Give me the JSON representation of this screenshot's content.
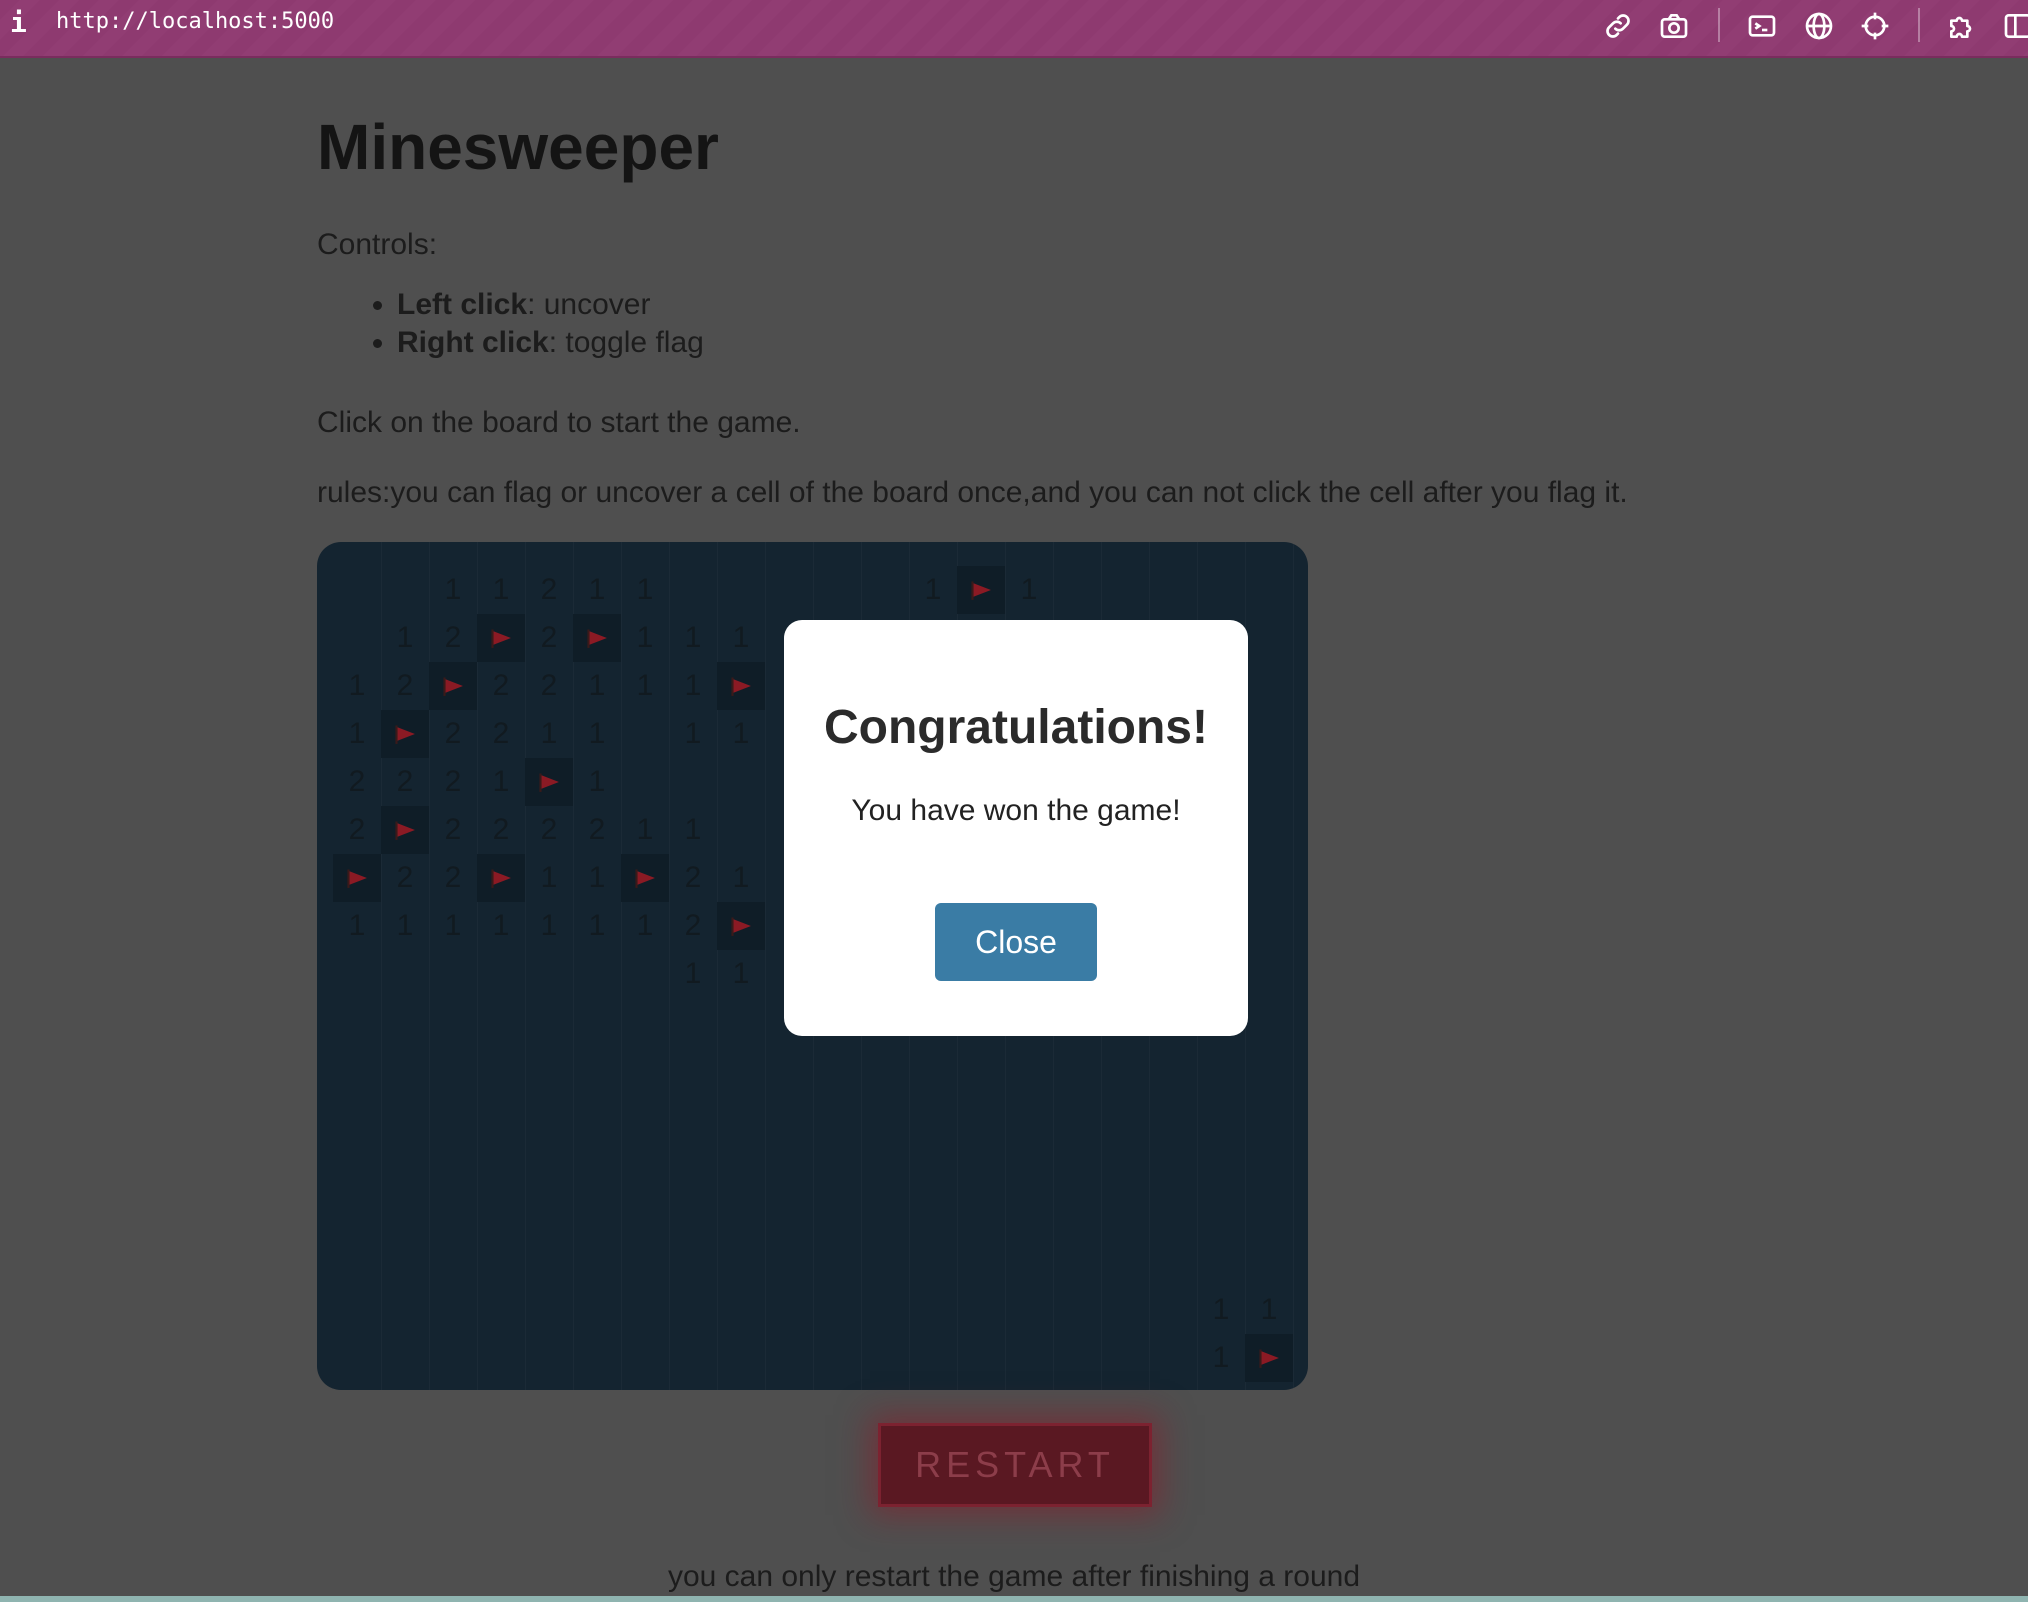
{
  "browser": {
    "info_glyph": "i",
    "url": "http://localhost:5000",
    "toolbar_icons": [
      "link-icon",
      "camera-icon",
      "terminal-icon",
      "globe-icon",
      "crosshair-icon",
      "puzzle-icon",
      "sidebar-icon"
    ]
  },
  "page": {
    "title": "Minesweeper",
    "controls_label": "Controls:",
    "controls": [
      {
        "key": "Left click",
        "action": ": uncover"
      },
      {
        "key": "Right click",
        "action": ": toggle flag"
      }
    ],
    "start_text": "Click on the board to start the game.",
    "rules_text": "rules:you can flag or uncover a cell of the board once,and you can not click the cell after you flag it.",
    "restart_label": "RESTART",
    "restart_note": "you can only restart the game after finishing a round"
  },
  "board": {
    "cells": [
      {
        "r": 0,
        "c": 2,
        "v": "1"
      },
      {
        "r": 0,
        "c": 3,
        "v": "1"
      },
      {
        "r": 0,
        "c": 4,
        "v": "2"
      },
      {
        "r": 0,
        "c": 5,
        "v": "1"
      },
      {
        "r": 0,
        "c": 6,
        "v": "1"
      },
      {
        "r": 0,
        "c": 12,
        "v": "1"
      },
      {
        "r": 0,
        "c": 13,
        "flag": true
      },
      {
        "r": 0,
        "c": 14,
        "v": "1"
      },
      {
        "r": 1,
        "c": 1,
        "v": "1"
      },
      {
        "r": 1,
        "c": 2,
        "v": "2"
      },
      {
        "r": 1,
        "c": 3,
        "flag": true
      },
      {
        "r": 1,
        "c": 4,
        "v": "2"
      },
      {
        "r": 1,
        "c": 5,
        "flag": true
      },
      {
        "r": 1,
        "c": 6,
        "v": "1"
      },
      {
        "r": 1,
        "c": 7,
        "v": "1"
      },
      {
        "r": 1,
        "c": 8,
        "v": "1"
      },
      {
        "r": 2,
        "c": 0,
        "v": "1"
      },
      {
        "r": 2,
        "c": 1,
        "v": "2"
      },
      {
        "r": 2,
        "c": 2,
        "flag": true
      },
      {
        "r": 2,
        "c": 3,
        "v": "2"
      },
      {
        "r": 2,
        "c": 4,
        "v": "2"
      },
      {
        "r": 2,
        "c": 5,
        "v": "1"
      },
      {
        "r": 2,
        "c": 6,
        "v": "1"
      },
      {
        "r": 2,
        "c": 7,
        "v": "1"
      },
      {
        "r": 2,
        "c": 8,
        "flag": true
      },
      {
        "r": 3,
        "c": 0,
        "v": "1"
      },
      {
        "r": 3,
        "c": 1,
        "flag": true
      },
      {
        "r": 3,
        "c": 2,
        "v": "2"
      },
      {
        "r": 3,
        "c": 3,
        "v": "2"
      },
      {
        "r": 3,
        "c": 4,
        "v": "1"
      },
      {
        "r": 3,
        "c": 5,
        "v": "1"
      },
      {
        "r": 3,
        "c": 7,
        "v": "1"
      },
      {
        "r": 3,
        "c": 8,
        "v": "1"
      },
      {
        "r": 4,
        "c": 0,
        "v": "2"
      },
      {
        "r": 4,
        "c": 1,
        "v": "2"
      },
      {
        "r": 4,
        "c": 2,
        "v": "2"
      },
      {
        "r": 4,
        "c": 3,
        "v": "1"
      },
      {
        "r": 4,
        "c": 4,
        "flag": true
      },
      {
        "r": 4,
        "c": 5,
        "v": "1"
      },
      {
        "r": 5,
        "c": 0,
        "v": "2"
      },
      {
        "r": 5,
        "c": 1,
        "flag": true
      },
      {
        "r": 5,
        "c": 2,
        "v": "2"
      },
      {
        "r": 5,
        "c": 3,
        "v": "2"
      },
      {
        "r": 5,
        "c": 4,
        "v": "2"
      },
      {
        "r": 5,
        "c": 5,
        "v": "2"
      },
      {
        "r": 5,
        "c": 6,
        "v": "1"
      },
      {
        "r": 5,
        "c": 7,
        "v": "1"
      },
      {
        "r": 6,
        "c": 0,
        "flag": true
      },
      {
        "r": 6,
        "c": 1,
        "v": "2"
      },
      {
        "r": 6,
        "c": 2,
        "v": "2"
      },
      {
        "r": 6,
        "c": 3,
        "flag": true
      },
      {
        "r": 6,
        "c": 4,
        "v": "1"
      },
      {
        "r": 6,
        "c": 5,
        "v": "1"
      },
      {
        "r": 6,
        "c": 6,
        "flag": true
      },
      {
        "r": 6,
        "c": 7,
        "v": "2"
      },
      {
        "r": 6,
        "c": 8,
        "v": "1"
      },
      {
        "r": 7,
        "c": 0,
        "v": "1"
      },
      {
        "r": 7,
        "c": 1,
        "v": "1"
      },
      {
        "r": 7,
        "c": 2,
        "v": "1"
      },
      {
        "r": 7,
        "c": 3,
        "v": "1"
      },
      {
        "r": 7,
        "c": 4,
        "v": "1"
      },
      {
        "r": 7,
        "c": 5,
        "v": "1"
      },
      {
        "r": 7,
        "c": 6,
        "v": "1"
      },
      {
        "r": 7,
        "c": 7,
        "v": "2"
      },
      {
        "r": 7,
        "c": 8,
        "flag": true
      },
      {
        "r": 8,
        "c": 7,
        "v": "1"
      },
      {
        "r": 8,
        "c": 8,
        "v": "1"
      },
      {
        "r": 15,
        "c": 18,
        "v": "1"
      },
      {
        "r": 15,
        "c": 19,
        "v": "1"
      },
      {
        "r": 16,
        "c": 18,
        "v": "1"
      },
      {
        "r": 16,
        "c": 19,
        "flag": true
      }
    ]
  },
  "modal": {
    "title": "Congratulations!",
    "message": "You have won the game!",
    "close_label": "Close"
  },
  "colors": {
    "topbar": "#8e3a70",
    "page_bg": "#4f4f4f",
    "board_bg": "#142430",
    "flag_red": "#8b1a24",
    "close_button": "#3a7ca5",
    "restart_border": "#7c2230"
  }
}
